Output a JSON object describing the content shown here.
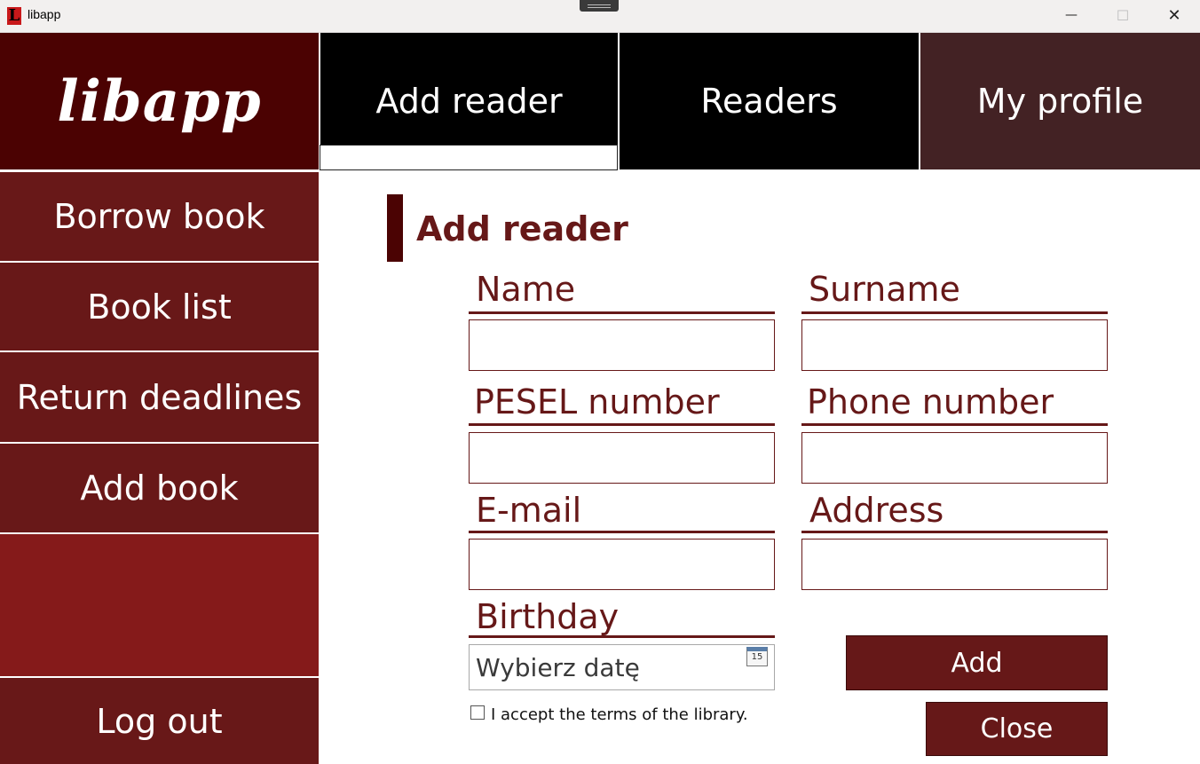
{
  "window": {
    "title": "libapp",
    "controls": {
      "minimize": "—",
      "maximize": "☐",
      "close": "✕"
    }
  },
  "brand": {
    "logo_text": "libapp"
  },
  "tabs": [
    {
      "label": "Add reader"
    },
    {
      "label": "Readers"
    },
    {
      "label": "My profile"
    }
  ],
  "sidebar": {
    "items": [
      {
        "label": "Borrow book"
      },
      {
        "label": "Book list"
      },
      {
        "label": "Return deadlines"
      },
      {
        "label": "Add book"
      }
    ],
    "logout_label": "Log out"
  },
  "form": {
    "title": "Add reader",
    "fields": {
      "name": {
        "label": "Name",
        "value": ""
      },
      "surname": {
        "label": "Surname",
        "value": ""
      },
      "pesel": {
        "label": "PESEL number",
        "value": ""
      },
      "phone": {
        "label": "Phone number",
        "value": ""
      },
      "email": {
        "label": "E-mail",
        "value": ""
      },
      "address": {
        "label": "Address",
        "value": ""
      }
    },
    "birthday": {
      "label": "Birthday",
      "placeholder": "Wybierz datę",
      "calendar_day": "15"
    },
    "terms_label": "I accept the terms of the library.",
    "terms_checked": false,
    "add_label": "Add",
    "close_label": "Close"
  },
  "colors": {
    "brand_dark": "#4b0202",
    "accent": "#661818",
    "sidebar_blank": "#851a1a",
    "profile_tab": "#432224"
  }
}
